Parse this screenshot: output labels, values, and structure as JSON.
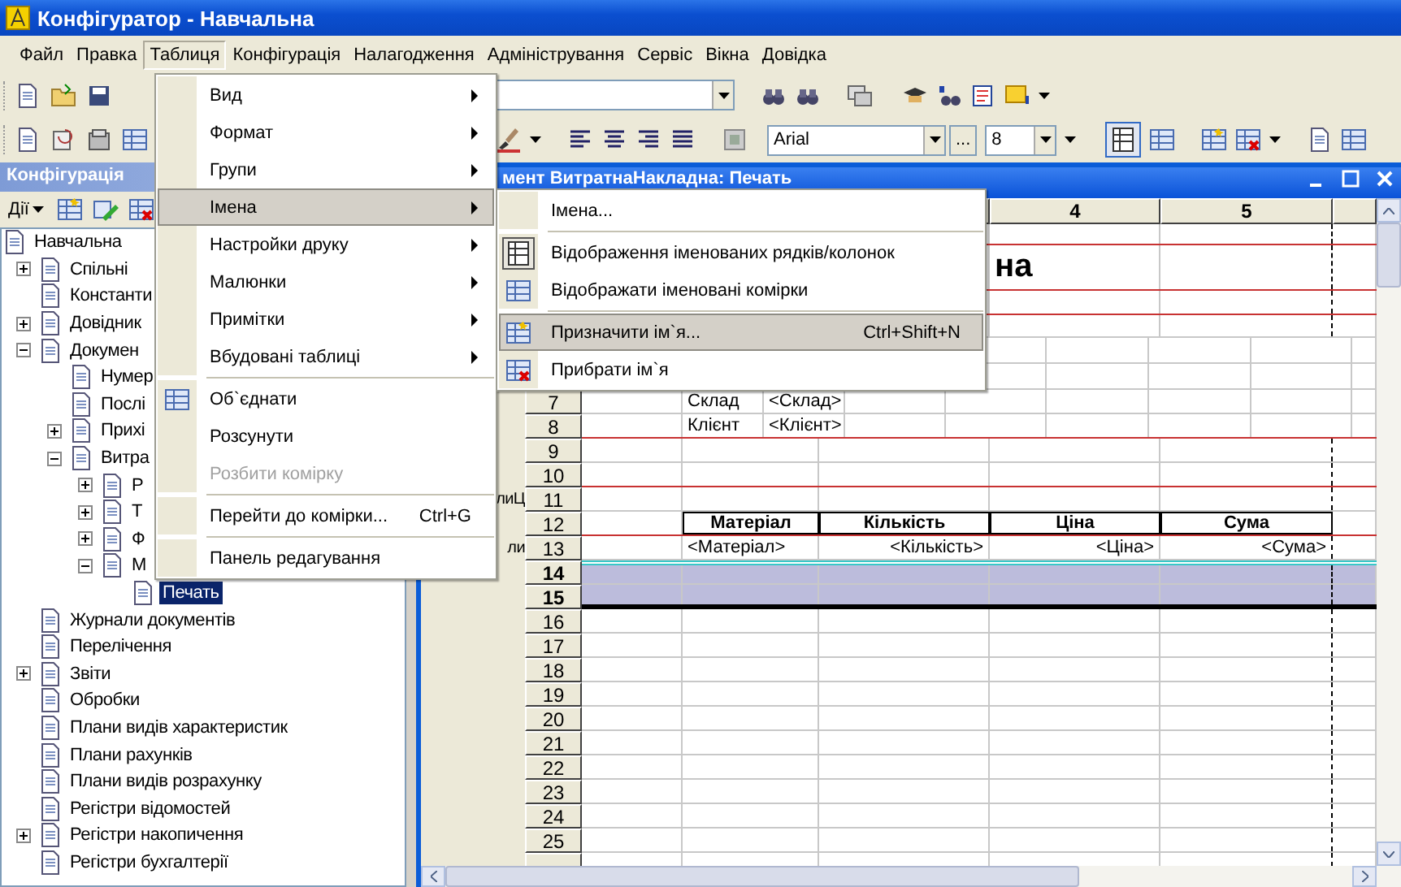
{
  "window": {
    "title": "Конфігуратор - Навчальна"
  },
  "menu_bar": [
    {
      "label": "Файл",
      "selected": false
    },
    {
      "label": "Правка",
      "selected": false
    },
    {
      "label": "Таблиця",
      "selected": true
    },
    {
      "label": "Конфігурація",
      "selected": false
    },
    {
      "label": "Налагодження",
      "selected": false
    },
    {
      "label": "Адміністрування",
      "selected": false
    },
    {
      "label": "Сервіс",
      "selected": false
    },
    {
      "label": "Вікна",
      "selected": false
    },
    {
      "label": "Довідка",
      "selected": false
    }
  ],
  "toolbar": {
    "font": "Arial",
    "font_button": "...",
    "size": "8"
  },
  "table_menu": [
    {
      "kind": "submenu",
      "label": "Вид",
      "selected": false,
      "disabled": false
    },
    {
      "kind": "submenu",
      "label": "Формат",
      "selected": false,
      "disabled": false
    },
    {
      "kind": "submenu",
      "label": "Групи",
      "selected": false,
      "disabled": false
    },
    {
      "kind": "submenu",
      "label": "Імена",
      "selected": true,
      "disabled": false
    },
    {
      "kind": "submenu",
      "label": "Настройки друку",
      "selected": false,
      "disabled": false
    },
    {
      "kind": "submenu",
      "label": "Малюнки",
      "selected": false,
      "disabled": false
    },
    {
      "kind": "submenu",
      "label": "Примітки",
      "selected": false,
      "disabled": false
    },
    {
      "kind": "submenu",
      "label": "Вбудовані таблиці",
      "selected": false,
      "disabled": false
    },
    {
      "kind": "separator"
    },
    {
      "kind": "command",
      "label": "Об`єднати",
      "selected": false,
      "disabled": false
    },
    {
      "kind": "command",
      "label": "Розсунути",
      "selected": false,
      "disabled": false
    },
    {
      "kind": "command",
      "label": "Розбити комірку",
      "selected": false,
      "disabled": true
    },
    {
      "kind": "separator"
    },
    {
      "kind": "command",
      "label": "Перейти до комірки...",
      "shortcut": "Ctrl+G",
      "selected": false,
      "disabled": false
    },
    {
      "kind": "separator"
    },
    {
      "kind": "command",
      "label": "Панель редагування",
      "selected": false,
      "disabled": false
    }
  ],
  "names_submenu": [
    {
      "kind": "command",
      "label": "Імена...",
      "selected": false
    },
    {
      "kind": "separator"
    },
    {
      "kind": "command",
      "label": "Відображення іменованих рядків/колонок",
      "selected": false,
      "checked": true
    },
    {
      "kind": "command",
      "label": "Відображати іменовані комірки",
      "selected": false,
      "checked": false
    },
    {
      "kind": "separator"
    },
    {
      "kind": "command",
      "label": "Призначити ім`я...",
      "shortcut": "Ctrl+Shift+N",
      "selected": true
    },
    {
      "kind": "command",
      "label": "Прибрати ім`я",
      "selected": false
    }
  ],
  "config_panel": {
    "title": "Конфігурація",
    "actions": "Дії",
    "tree": [
      {
        "label": "Навчальна",
        "selected": false,
        "children": [
          {
            "label": "Спільні",
            "expanded": false,
            "selected": false
          },
          {
            "label": "Константи",
            "selected": false
          },
          {
            "label": "Довідник",
            "expanded": false,
            "selected": false
          },
          {
            "label": "Докумен",
            "expanded": true,
            "selected": false,
            "children": [
              {
                "label": "Нумер",
                "selected": false
              },
              {
                "label": "Послі",
                "selected": false
              },
              {
                "label": "Прихі",
                "expanded": false,
                "selected": false
              },
              {
                "label": "Витра",
                "expanded": true,
                "selected": false,
                "children": [
                  {
                    "label": "Р",
                    "expanded": false,
                    "selected": false
                  },
                  {
                    "label": "Т",
                    "expanded": false,
                    "selected": false
                  },
                  {
                    "label": "Ф",
                    "expanded": false,
                    "selected": false
                  },
                  {
                    "label": "М",
                    "expanded": true,
                    "selected": false,
                    "children": [
                      {
                        "label": "Печать",
                        "selected": true
                      }
                    ]
                  }
                ]
              }
            ]
          },
          {
            "label": "Журнали документів",
            "selected": false
          },
          {
            "label": "Перелічення",
            "selected": false
          },
          {
            "label": "Звіти",
            "expanded": false,
            "selected": false
          },
          {
            "label": "Обробки",
            "selected": false
          },
          {
            "label": "Плани видів характеристик",
            "selected": false
          },
          {
            "label": "Плани рахунків",
            "selected": false
          },
          {
            "label": "Плани видів розрахунку",
            "selected": false
          },
          {
            "label": "Регістри відомостей",
            "selected": false
          },
          {
            "label": "Регістри накопичення",
            "expanded": false,
            "selected": false
          },
          {
            "label": "Регістри бухгалтерії",
            "selected": false
          }
        ]
      }
    ]
  },
  "document_window": {
    "title": "мент ВитратнаНакладна: Печать",
    "columns": [
      "",
      "",
      "",
      "4",
      "5"
    ],
    "rows": [
      {
        "kind": "title",
        "cells": [],
        "area_border": true,
        "selected": false
      },
      {
        "kind": "title",
        "cells": [
          "",
          "",
          "",
          "на"
        ],
        "area_border": true,
        "selected": false
      },
      {
        "kind": "title",
        "cells": [],
        "area_border": true,
        "selected": false
      },
      {
        "kind": "title",
        "cells": [],
        "area_border": false,
        "selected": false
      },
      {
        "kind": "info",
        "cells": [],
        "area_border": false,
        "selected": false
      },
      {
        "kind": "info",
        "cells": [],
        "area_border": false,
        "selected": false
      },
      {
        "kind": "info",
        "number": "7",
        "cells": [
          "",
          "Склад",
          "<Склад>"
        ],
        "area_border": false,
        "selected": false
      },
      {
        "kind": "info",
        "number": "8",
        "cells": [
          "",
          "Клієнт",
          "<Клієнт>"
        ],
        "area_border": true,
        "selected": false
      },
      {
        "kind": "table",
        "number": "9",
        "cells": [],
        "area_border": false,
        "selected": false
      },
      {
        "kind": "table",
        "number": "10",
        "cells": [],
        "area_border": true,
        "selected": false
      },
      {
        "kind": "table",
        "number": "11",
        "area": "лиЦ",
        "cells": [],
        "area_border": false,
        "selected": false
      },
      {
        "kind": "table-head",
        "number": "12",
        "cells": [
          "",
          "Матеріал",
          "Кількість",
          "Ціна",
          "Сума"
        ],
        "area_border": true,
        "selected": false
      },
      {
        "kind": "table-body",
        "number": "13",
        "area": "ли",
        "cells": [
          "",
          "<Матеріал>",
          "<Кількість>",
          "<Ціна>",
          "<Сума>"
        ],
        "area_border": false,
        "selected": false
      },
      {
        "kind": "table",
        "number": "14",
        "cells": [],
        "area_border": false,
        "selected": true
      },
      {
        "kind": "table",
        "number": "15",
        "cells": [],
        "selected": true
      },
      {
        "kind": "table",
        "number": "16",
        "cells": [],
        "area_border": false,
        "selected": false
      },
      {
        "kind": "table",
        "number": "17",
        "cells": [],
        "area_border": false,
        "selected": false
      },
      {
        "kind": "table",
        "number": "18",
        "cells": [],
        "area_border": false,
        "selected": false
      },
      {
        "kind": "table",
        "number": "19",
        "cells": [],
        "area_border": false,
        "selected": false
      },
      {
        "kind": "table",
        "number": "20",
        "cells": [],
        "area_border": false,
        "selected": false
      },
      {
        "kind": "table",
        "number": "21",
        "cells": [],
        "area_border": false,
        "selected": false
      },
      {
        "kind": "table",
        "number": "22",
        "cells": [],
        "area_border": false,
        "selected": false
      },
      {
        "kind": "table",
        "number": "23",
        "cells": [],
        "area_border": false,
        "selected": false
      },
      {
        "kind": "table",
        "number": "24",
        "cells": [],
        "area_border": false,
        "selected": false
      },
      {
        "kind": "table",
        "number": "25",
        "cells": [],
        "area_border": false,
        "selected": false
      },
      {
        "kind": "table",
        "cells": [],
        "selected": false
      }
    ]
  }
}
